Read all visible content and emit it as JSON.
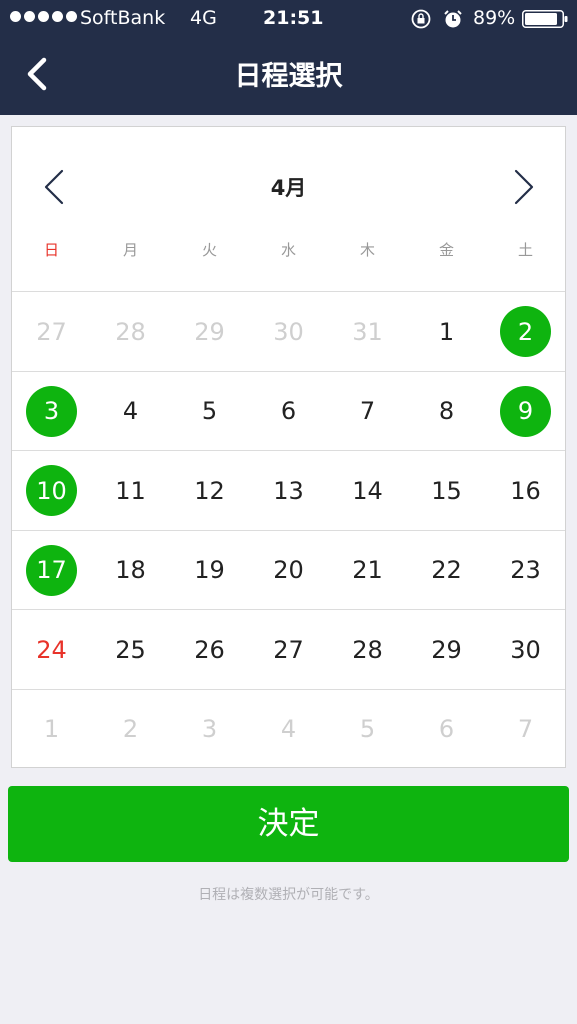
{
  "status_bar": {
    "carrier": "SoftBank",
    "network": "4G",
    "time": "21:51",
    "battery": "89%",
    "battery_level": 0.89,
    "icons": [
      "signal-dots-icon",
      "rotation-lock-icon",
      "alarm-icon",
      "battery-icon"
    ]
  },
  "nav": {
    "title": "日程選択",
    "back_icon": "chevron-left-icon"
  },
  "calendar": {
    "month": "4月",
    "prev_icon": "chevron-left-icon",
    "next_icon": "chevron-right-icon",
    "weekdays": [
      "日",
      "月",
      "火",
      "水",
      "木",
      "金",
      "土"
    ],
    "weeks": [
      [
        {
          "d": "27",
          "other": true
        },
        {
          "d": "28",
          "other": true
        },
        {
          "d": "29",
          "other": true
        },
        {
          "d": "30",
          "other": true
        },
        {
          "d": "31",
          "other": true
        },
        {
          "d": "1"
        },
        {
          "d": "2",
          "selected": true
        }
      ],
      [
        {
          "d": "3",
          "selected": true
        },
        {
          "d": "4"
        },
        {
          "d": "5"
        },
        {
          "d": "6"
        },
        {
          "d": "7"
        },
        {
          "d": "8"
        },
        {
          "d": "9",
          "selected": true
        }
      ],
      [
        {
          "d": "10",
          "selected": true
        },
        {
          "d": "11"
        },
        {
          "d": "12"
        },
        {
          "d": "13"
        },
        {
          "d": "14"
        },
        {
          "d": "15"
        },
        {
          "d": "16"
        }
      ],
      [
        {
          "d": "17",
          "selected": true
        },
        {
          "d": "18"
        },
        {
          "d": "19"
        },
        {
          "d": "20"
        },
        {
          "d": "21"
        },
        {
          "d": "22"
        },
        {
          "d": "23"
        }
      ],
      [
        {
          "d": "24",
          "sunday_red": true
        },
        {
          "d": "25"
        },
        {
          "d": "26"
        },
        {
          "d": "27"
        },
        {
          "d": "28"
        },
        {
          "d": "29"
        },
        {
          "d": "30"
        }
      ],
      [
        {
          "d": "1",
          "other": true
        },
        {
          "d": "2",
          "other": true
        },
        {
          "d": "3",
          "other": true
        },
        {
          "d": "4",
          "other": true
        },
        {
          "d": "5",
          "other": true
        },
        {
          "d": "6",
          "other": true
        },
        {
          "d": "7",
          "other": true
        }
      ]
    ]
  },
  "confirm_button": "決定",
  "hint": "日程は複数選択が可能です。",
  "colors": {
    "header": "#232e48",
    "accent": "#0eb40f",
    "sunday": "#e8332a",
    "background": "#efeff4"
  }
}
